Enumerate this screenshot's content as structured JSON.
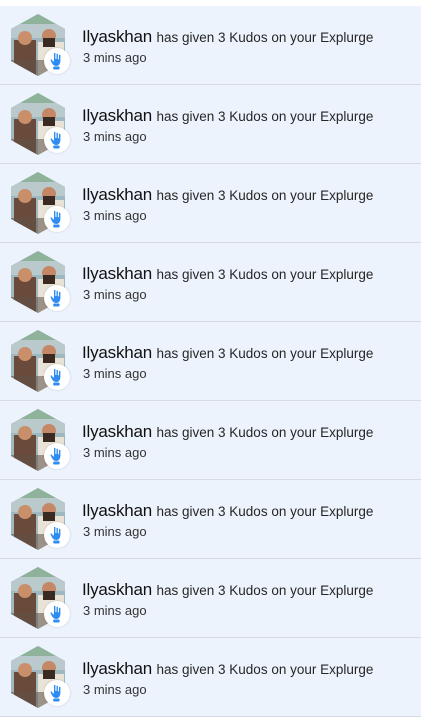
{
  "notifications": [
    {
      "username": "Ilyaskhan",
      "action": "has given 3 Kudos on your Explurge",
      "time": "3 mins ago",
      "avatar_icon": "user-photo-avatar",
      "badge_icon": "kudos-hand-icon"
    },
    {
      "username": "Ilyaskhan",
      "action": "has given 3 Kudos on your Explurge",
      "time": "3 mins ago",
      "avatar_icon": "user-photo-avatar",
      "badge_icon": "kudos-hand-icon"
    },
    {
      "username": "Ilyaskhan",
      "action": "has given 3 Kudos on your Explurge",
      "time": "3 mins ago",
      "avatar_icon": "user-photo-avatar",
      "badge_icon": "kudos-hand-icon"
    },
    {
      "username": "Ilyaskhan",
      "action": "has given 3 Kudos on your Explurge",
      "time": "3 mins ago",
      "avatar_icon": "user-photo-avatar",
      "badge_icon": "kudos-hand-icon"
    },
    {
      "username": "Ilyaskhan",
      "action": "has given 3 Kudos on your Explurge",
      "time": "3 mins ago",
      "avatar_icon": "user-photo-avatar",
      "badge_icon": "kudos-hand-icon"
    },
    {
      "username": "Ilyaskhan",
      "action": "has given 3 Kudos on your Explurge",
      "time": "3 mins ago",
      "avatar_icon": "user-photo-avatar",
      "badge_icon": "kudos-hand-icon"
    },
    {
      "username": "Ilyaskhan",
      "action": "has given 3 Kudos on your Explurge",
      "time": "3 mins ago",
      "avatar_icon": "user-photo-avatar",
      "badge_icon": "kudos-hand-icon"
    },
    {
      "username": "Ilyaskhan",
      "action": "has given 3 Kudos on your Explurge",
      "time": "3 mins ago",
      "avatar_icon": "user-photo-avatar",
      "badge_icon": "kudos-hand-icon"
    },
    {
      "username": "Ilyaskhan",
      "action": "has given 3 Kudos on your Explurge",
      "time": "3 mins ago",
      "avatar_icon": "user-photo-avatar",
      "badge_icon": "kudos-hand-icon"
    }
  ],
  "colors": {
    "row_background": "#edf3fd",
    "divider": "#d6dbe4",
    "badge_icon": "#2f8cf3"
  }
}
